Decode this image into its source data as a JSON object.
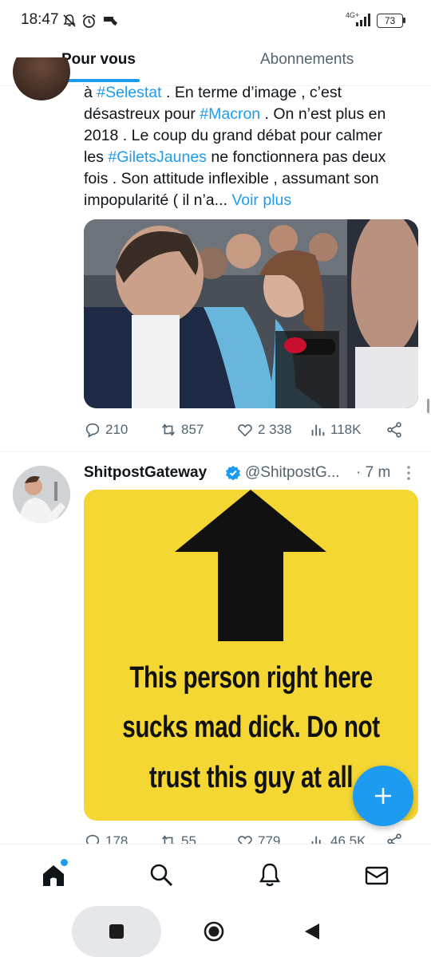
{
  "status_bar": {
    "time": "18:47",
    "network": "4G+",
    "battery": "73"
  },
  "tabs": [
    {
      "label": "Pour vous"
    },
    {
      "label": "Abonnements"
    }
  ],
  "tweet1": {
    "text_lines": [
      {
        "parts": [
          [
            "à ",
            false
          ],
          [
            "#Selestat",
            true
          ],
          [
            " . En terme d’image , c’est",
            false
          ]
        ]
      },
      {
        "parts": [
          [
            "désastreux pour ",
            false
          ],
          [
            "#Macron",
            true
          ],
          [
            " . On n’est plus en",
            false
          ]
        ]
      },
      {
        "parts": [
          [
            "2018 . Le coup du grand débat pour calmer",
            false
          ]
        ]
      },
      {
        "parts": [
          [
            "les ",
            false
          ],
          [
            "#GiletsJaunes",
            true
          ],
          [
            " ne fonctionnera pas deux",
            false
          ]
        ]
      },
      {
        "parts": [
          [
            "fois . Son attitude inflexible , assumant son",
            false
          ]
        ]
      },
      {
        "parts": [
          [
            "impopularité ( il n’a... ",
            false
          ],
          [
            "Voir plus",
            true
          ]
        ]
      }
    ],
    "replies": "210",
    "retweets": "857",
    "likes": "2 338",
    "views": "118K"
  },
  "tweet2": {
    "author": "ShitpostGateway",
    "handle": "@ShitpostG...",
    "time": "· 7 m",
    "meme_lines": [
      "This person right here",
      "sucks mad dick. Do not",
      "trust this guy at all"
    ],
    "replies": "178",
    "retweets": "55",
    "likes": "779",
    "views": "46,5K"
  },
  "colors": {
    "accent": "#1d9bf0",
    "meme_bg": "#f4d733"
  }
}
